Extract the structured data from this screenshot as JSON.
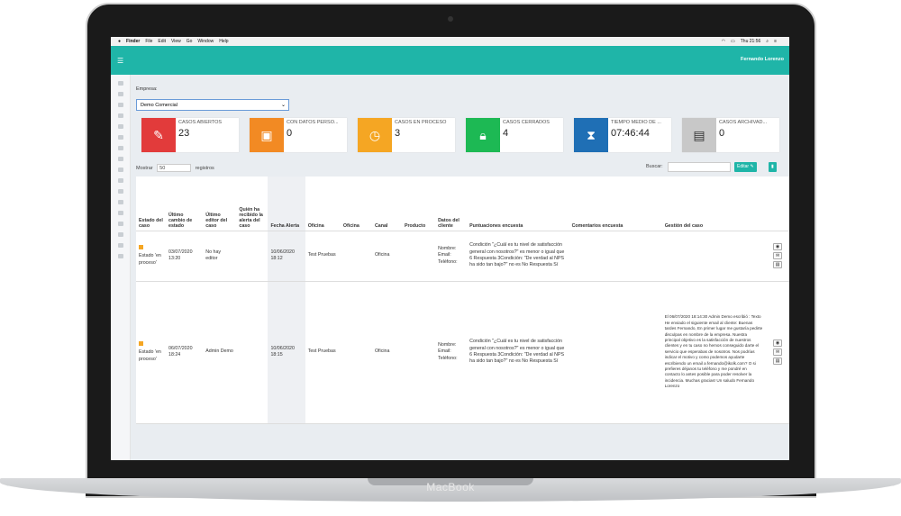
{
  "device": {
    "brand": "MacBook"
  },
  "menubar": {
    "apple": "",
    "items": [
      "Finder",
      "File",
      "Edit",
      "View",
      "Go",
      "Window",
      "Help"
    ],
    "clock": "Thu 21:56"
  },
  "header": {
    "menu_icon": "hamburger-icon",
    "user": "Fernando Lorenzo"
  },
  "empresa": {
    "label": "Empresa:",
    "value": "Demo Comercial"
  },
  "cards": [
    {
      "title": "CASOS ABIERTOS",
      "value": "23",
      "color": "#e23b3b",
      "icon": "user-edit-icon"
    },
    {
      "title": "CON DATOS PERSO...",
      "value": "0",
      "color": "#f28a23",
      "icon": "contact-card-icon"
    },
    {
      "title": "CASOS EN PROCESO",
      "value": "3",
      "color": "#f5a623",
      "icon": "user-clock-icon"
    },
    {
      "title": "CASOS CERRADOS",
      "value": "4",
      "color": "#1db954",
      "icon": "user-lock-icon"
    },
    {
      "title": "TIEMPO MEDIO DE ...",
      "value": "07:46:44",
      "color": "#1f6fb5",
      "icon": "hourglass-icon"
    },
    {
      "title": "CASOS ARCHIVAD...",
      "value": "0",
      "color": "#c8c8c8",
      "icon": "archive-icon"
    }
  ],
  "toolbar": {
    "mostrar": "Mostrar",
    "entries": "50",
    "registros": "registros",
    "buscar": "Buscar:",
    "editar": "Editar"
  },
  "table": {
    "headers": [
      "Estado del caso",
      "Último cambio de estado",
      "Último editor del caso",
      "Quién ha recibido la alerta del caso",
      "Fecha Alerta",
      "Oficina",
      "Oficina",
      "Canal",
      "Producto",
      "Datos del cliente",
      "Puntuaciones encuesta",
      "Comentarios encuesta",
      "Gestión del caso"
    ],
    "rows": [
      {
        "estado": "Estado 'en proceso'",
        "cambio": "03/07/2020 13:20",
        "editor": "No hay editor",
        "recibido": "",
        "fecha": "10/06/2020 18:12",
        "oficina": "Test Pruebas",
        "oficina2": "",
        "canal": "Oficina",
        "producto": "",
        "cliente": "Nombre: Email: Teléfono:",
        "puntuaciones": "Condición \"¿Cuál es tu nivel de satisfacción general con nosotros?\" es menor o igual que 6 Respuesta 3Condición: \"De verdad al NPS ha sido tan bajo?\" no es No Respuesta Sí",
        "comentarios": "",
        "gestion": ""
      },
      {
        "estado": "Estado 'en proceso'",
        "cambio": "06/07/2020 18:24",
        "editor": "Admin Demo",
        "recibido": "",
        "fecha": "10/06/2020 18:15",
        "oficina": "Test Pruebas",
        "oficina2": "",
        "canal": "Oficina",
        "producto": "",
        "cliente": "Nombre: Email: Teléfono:",
        "puntuaciones": "Condición \"¿Cuál es tu nivel de satisfacción general con nosotros?\" es menor o igual que 6 Respuesta 3Condición: \"De verdad al NPS ha sido tan bajo?\" no es No Respuesta Sí",
        "comentarios": "",
        "gestion": "El 06/07/2020 18:14:30 Admin Demo escribió : Texto He enviado el siguiente email al cliente: Buenas tardes Fernando, En primer lugar me gustaría pedirte disculpas en nombre de la empresa. Nuestra principal objetivo es la satisfacción de nuestros clientes y en tu caso no hemos conseguido darte el servicio que esperabas de nosotros. Nos podrías indicar el motivo y como podemos ayudarte escribiendo un email a fernando@ikolk.com? O si prefieres déjanos tu teléfono y me pondré en contacto lo antes posible para poder resolver la incidencia. Muchas gracias! Un saludo Fernando Lorenzo"
      }
    ]
  }
}
